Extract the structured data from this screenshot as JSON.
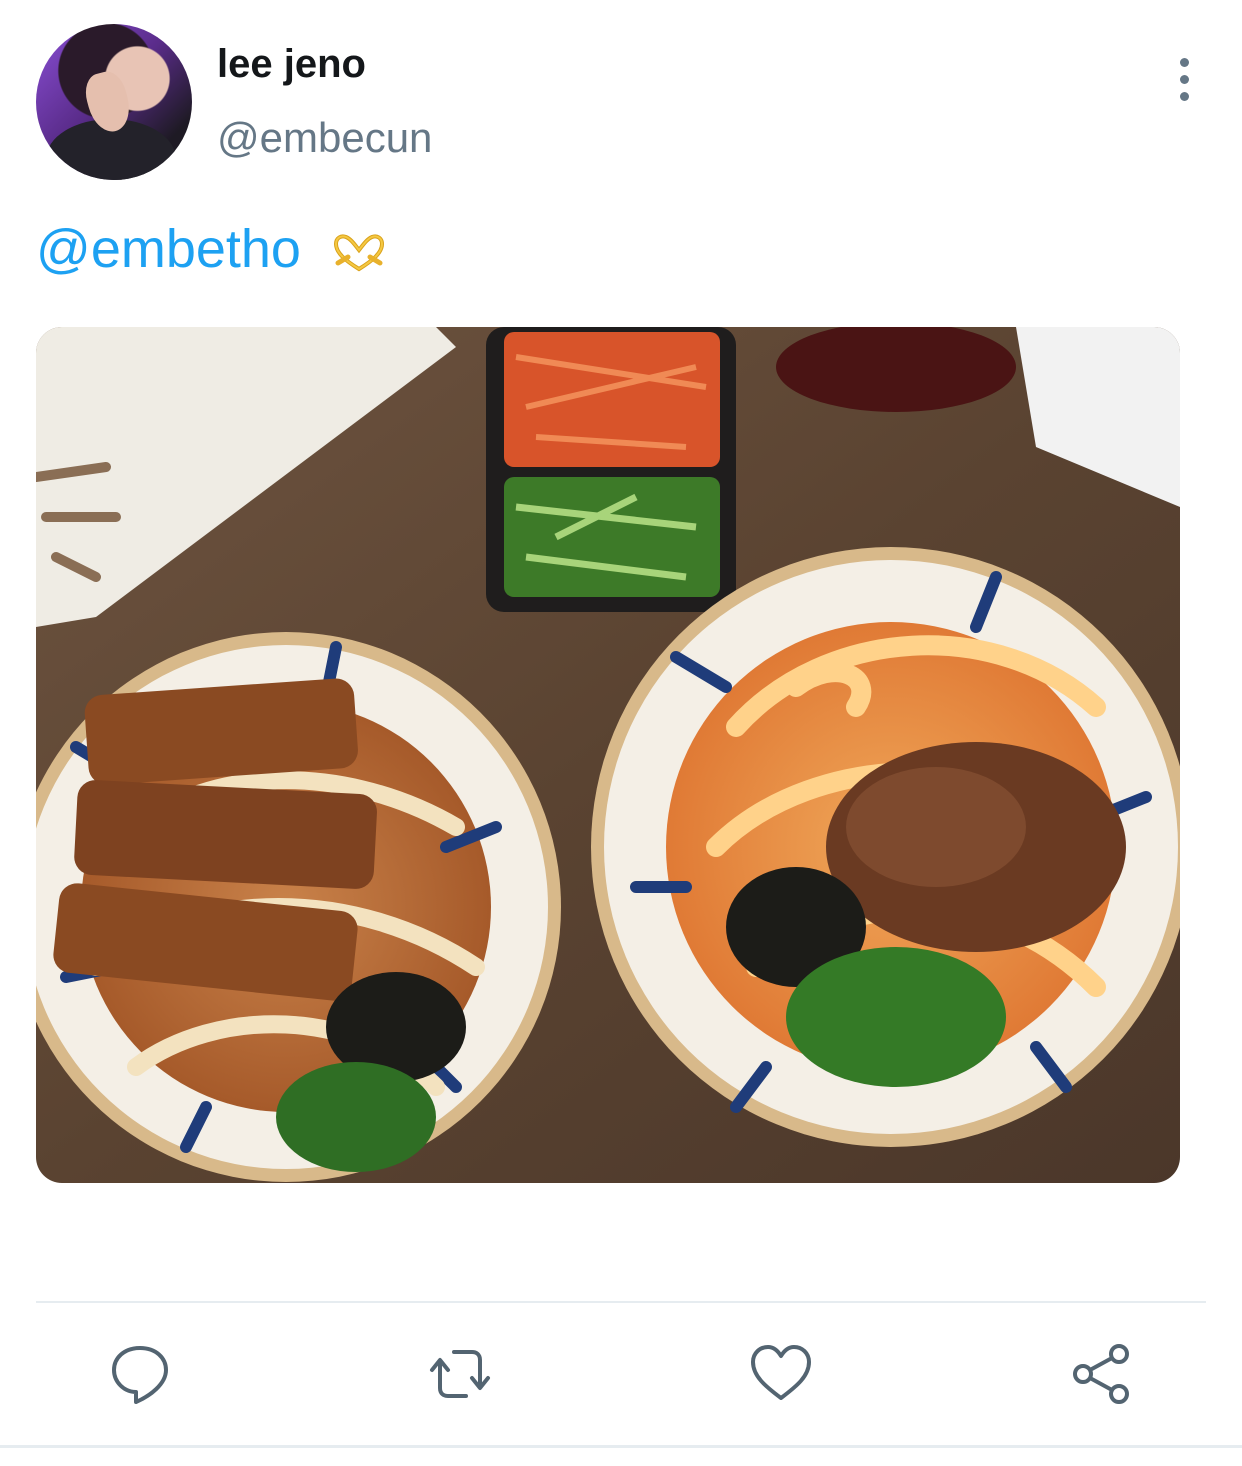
{
  "author": {
    "display_name": "lee jeno",
    "handle": "@embecun"
  },
  "tweet": {
    "mention": "@embetho",
    "emoji": "heart-hands-emoji"
  },
  "media": {
    "description_icon": "photo"
  },
  "actions": [
    {
      "name": "reply",
      "icon": "reply-icon"
    },
    {
      "name": "retweet",
      "icon": "retweet-icon"
    },
    {
      "name": "like",
      "icon": "heart-icon"
    },
    {
      "name": "share",
      "icon": "share-icon"
    }
  ],
  "colors": {
    "link": "#1da1f2",
    "secondary_text": "#657786",
    "icon": "#536471",
    "divider": "#e6ecf0"
  }
}
